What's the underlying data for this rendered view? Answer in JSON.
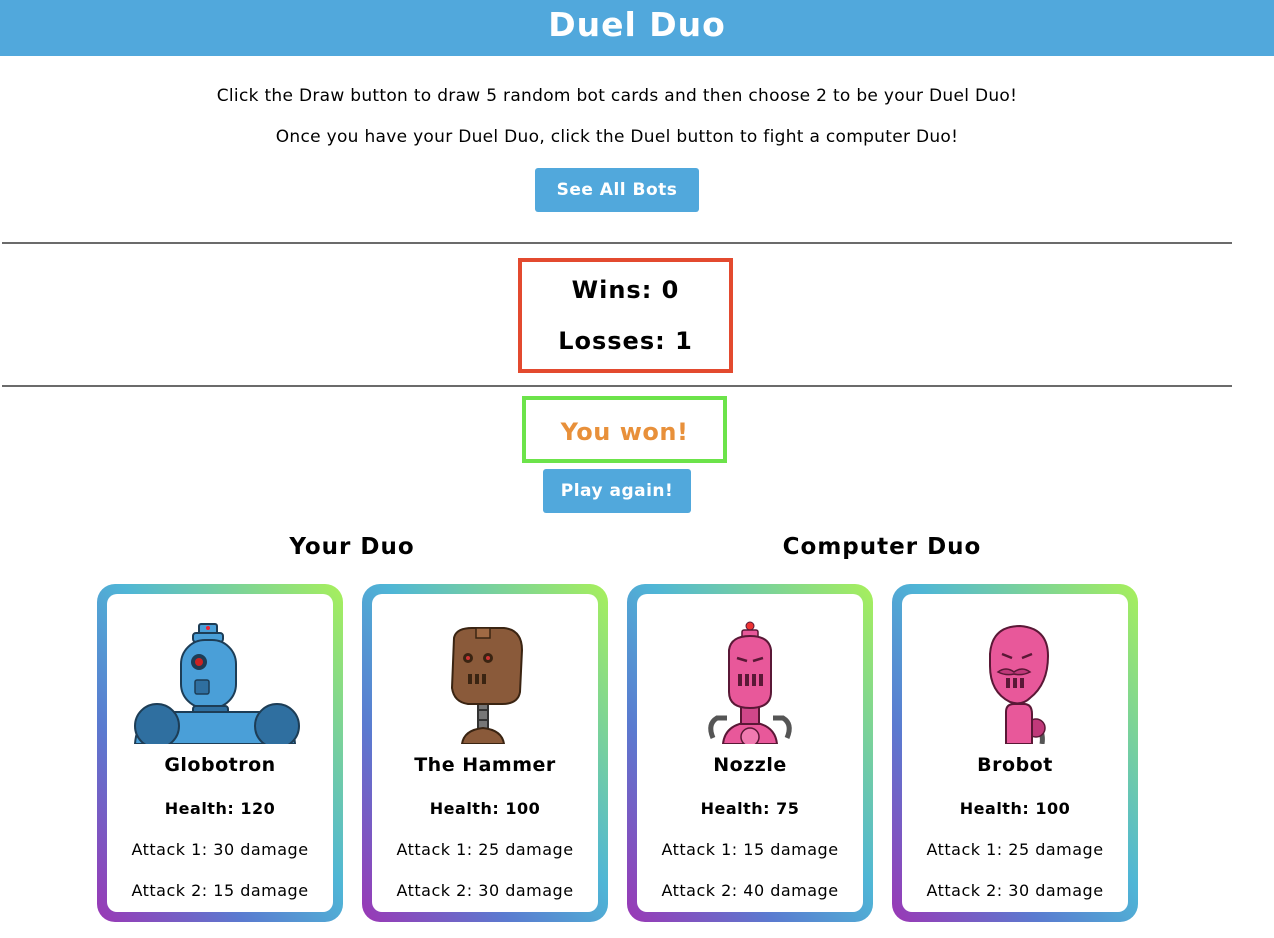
{
  "app": {
    "title": "Duel Duo"
  },
  "instructions": {
    "line1": "Click the Draw button to draw 5 random bot cards and then choose 2 to be your Duel Duo!",
    "line2": "Once you have your Duel Duo, click the Duel button to fight a computer Duo!"
  },
  "buttons": {
    "see_all": "See All Bots",
    "play_again": "Play again!"
  },
  "score": {
    "wins": "Wins: 0",
    "losses": "Losses: 1"
  },
  "result": {
    "text": "You won!"
  },
  "your_duo": {
    "title": "Your Duo",
    "bots": [
      {
        "name": "Globotron",
        "health": "Health: 120",
        "attack1": "Attack 1: 30 damage",
        "attack2": "Attack 2: 15 damage",
        "color": "#4a9fd8"
      },
      {
        "name": "The Hammer",
        "health": "Health: 100",
        "attack1": "Attack 1: 25 damage",
        "attack2": "Attack 2: 30 damage",
        "color": "#8a5a3a"
      }
    ]
  },
  "computer_duo": {
    "title": "Computer Duo",
    "bots": [
      {
        "name": "Nozzle",
        "health": "Health: 75",
        "attack1": "Attack 1: 15 damage",
        "attack2": "Attack 2: 40 damage",
        "color": "#e8589a"
      },
      {
        "name": "Brobot",
        "health": "Health: 100",
        "attack1": "Attack 1: 25 damage",
        "attack2": "Attack 2: 30 damage",
        "color": "#e8589a"
      }
    ]
  },
  "colors": {
    "header": "#51a8dc",
    "score_border": "#e34a2f",
    "result_border": "#6ce34a",
    "result_text": "#e8903a"
  }
}
